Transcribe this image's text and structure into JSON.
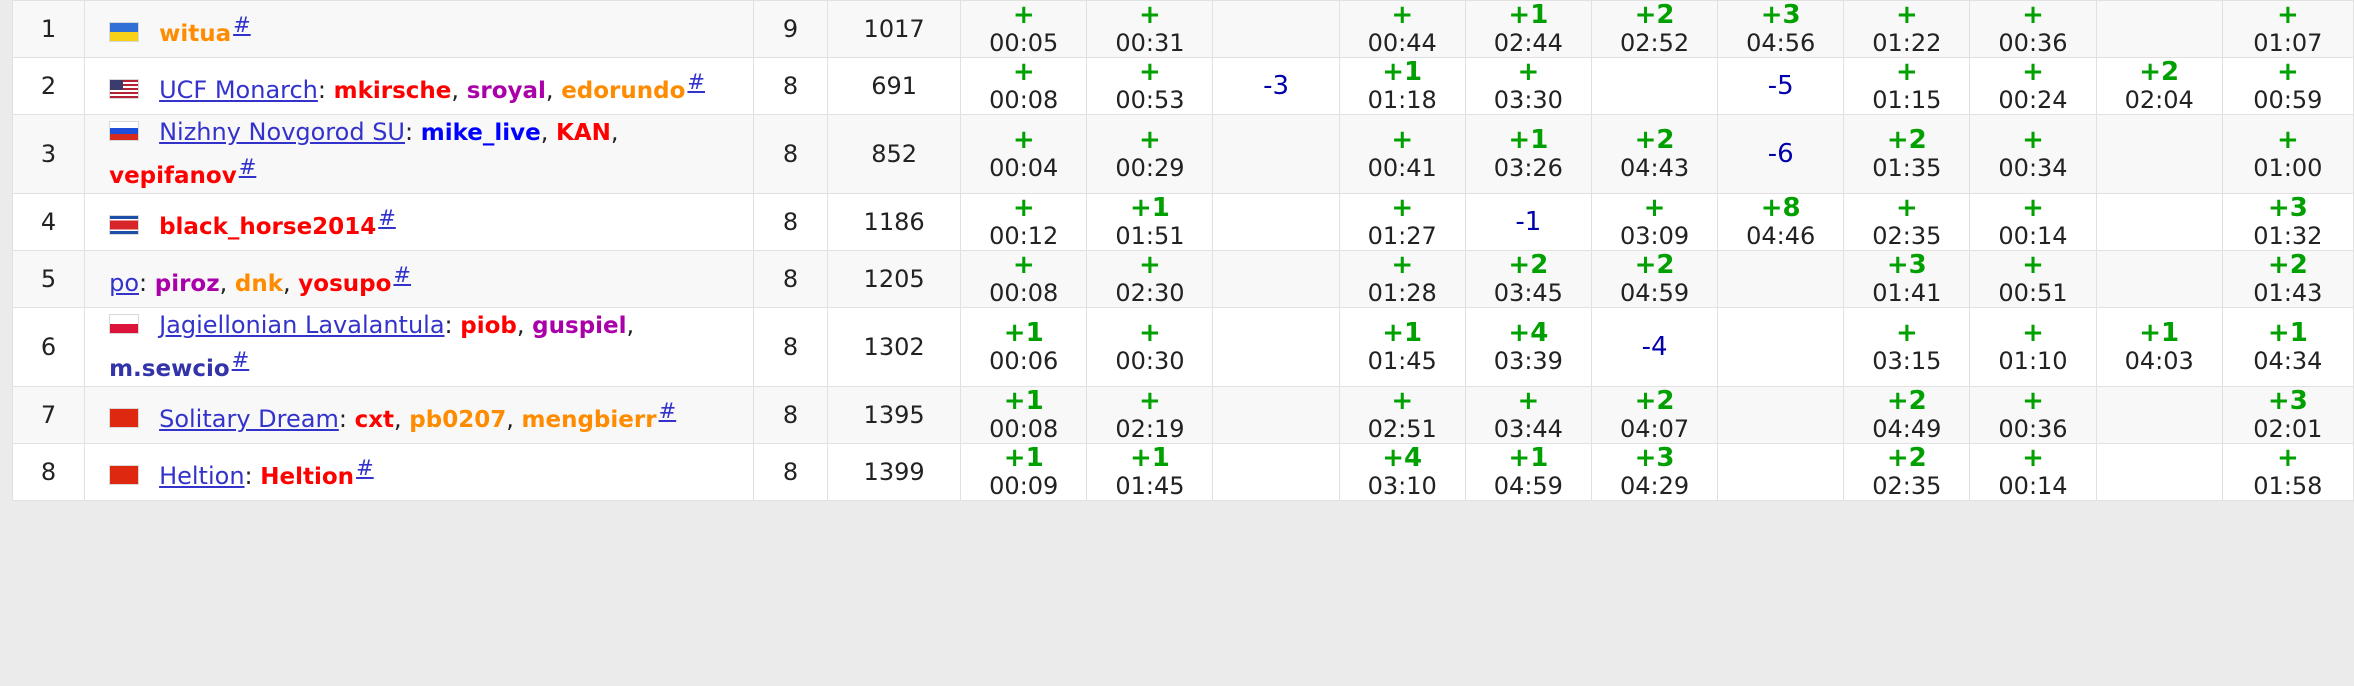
{
  "colors": {
    "accepted": "#00a000",
    "rejected": "#0000aa",
    "team_link": "#3333cc",
    "handle_red": "#ff0000",
    "handle_orange": "#ff8c00",
    "handle_violet": "#aa00aa",
    "handle_blue": "#0000ff",
    "handle_darkblue": "#3333aa"
  },
  "rows": [
    {
      "rank": "1",
      "flag": "ua",
      "team": "",
      "colon": "",
      "members": [
        {
          "name": "witua",
          "color": "#ff8c00"
        }
      ],
      "hash": "#",
      "solved": "9",
      "penalty": "1017",
      "problems": [
        {
          "res": "+",
          "time": "00:05"
        },
        {
          "res": "+",
          "time": "00:31"
        },
        {
          "res": "",
          "time": ""
        },
        {
          "res": "+",
          "time": "00:44"
        },
        {
          "res": "+1",
          "time": "02:44"
        },
        {
          "res": "+2",
          "time": "02:52"
        },
        {
          "res": "+3",
          "time": "04:56"
        },
        {
          "res": "+",
          "time": "01:22"
        },
        {
          "res": "+",
          "time": "00:36"
        },
        {
          "res": "",
          "time": ""
        },
        {
          "res": "+",
          "time": "01:07"
        }
      ]
    },
    {
      "rank": "2",
      "flag": "us",
      "team": "UCF Monarch",
      "colon": ":",
      "members": [
        {
          "name": "mkirsche",
          "color": "#ff0000"
        },
        {
          "name": "sroyal",
          "color": "#aa00aa"
        },
        {
          "name": "edorundo",
          "color": "#ff8c00"
        }
      ],
      "hash": "#",
      "solved": "8",
      "penalty": "691",
      "problems": [
        {
          "res": "+",
          "time": "00:08"
        },
        {
          "res": "+",
          "time": "00:53"
        },
        {
          "res": "-3",
          "time": ""
        },
        {
          "res": "+1",
          "time": "01:18"
        },
        {
          "res": "+",
          "time": "03:30"
        },
        {
          "res": "",
          "time": ""
        },
        {
          "res": "-5",
          "time": ""
        },
        {
          "res": "+",
          "time": "01:15"
        },
        {
          "res": "+",
          "time": "00:24"
        },
        {
          "res": "+2",
          "time": "02:04"
        },
        {
          "res": "+",
          "time": "00:59"
        }
      ]
    },
    {
      "rank": "3",
      "flag": "ru",
      "team": "Nizhny Novgorod SU",
      "colon": ":",
      "members": [
        {
          "name": "mike_live",
          "color": "#0000ff"
        },
        {
          "name": "KAN",
          "color": "#ff0000"
        },
        {
          "name": "vepifanov",
          "color": "#ff0000"
        }
      ],
      "hash": "#",
      "solved": "8",
      "penalty": "852",
      "problems": [
        {
          "res": "+",
          "time": "00:04"
        },
        {
          "res": "+",
          "time": "00:29"
        },
        {
          "res": "",
          "time": ""
        },
        {
          "res": "+",
          "time": "00:41"
        },
        {
          "res": "+1",
          "time": "03:26"
        },
        {
          "res": "+2",
          "time": "04:43"
        },
        {
          "res": "-6",
          "time": ""
        },
        {
          "res": "+2",
          "time": "01:35"
        },
        {
          "res": "+",
          "time": "00:34"
        },
        {
          "res": "",
          "time": ""
        },
        {
          "res": "+",
          "time": "01:00"
        }
      ]
    },
    {
      "rank": "4",
      "flag": "kp",
      "team": "",
      "colon": "",
      "members": [
        {
          "name": "black_horse2014",
          "color": "#ff0000"
        }
      ],
      "hash": "#",
      "solved": "8",
      "penalty": "1186",
      "problems": [
        {
          "res": "+",
          "time": "00:12"
        },
        {
          "res": "+1",
          "time": "01:51"
        },
        {
          "res": "",
          "time": ""
        },
        {
          "res": "+",
          "time": "01:27"
        },
        {
          "res": "-1",
          "time": ""
        },
        {
          "res": "+",
          "time": "03:09"
        },
        {
          "res": "+8",
          "time": "04:46"
        },
        {
          "res": "+",
          "time": "02:35"
        },
        {
          "res": "+",
          "time": "00:14"
        },
        {
          "res": "",
          "time": ""
        },
        {
          "res": "+3",
          "time": "01:32"
        }
      ]
    },
    {
      "rank": "5",
      "flag": "",
      "team": "po",
      "colon": ":",
      "members": [
        {
          "name": "piroz",
          "color": "#aa00aa"
        },
        {
          "name": "dnk",
          "color": "#ff8c00"
        },
        {
          "name": "yosupo",
          "color": "#ff0000"
        }
      ],
      "hash": "#",
      "solved": "8",
      "penalty": "1205",
      "problems": [
        {
          "res": "+",
          "time": "00:08"
        },
        {
          "res": "+",
          "time": "02:30"
        },
        {
          "res": "",
          "time": ""
        },
        {
          "res": "+",
          "time": "01:28"
        },
        {
          "res": "+2",
          "time": "03:45"
        },
        {
          "res": "+2",
          "time": "04:59"
        },
        {
          "res": "",
          "time": ""
        },
        {
          "res": "+3",
          "time": "01:41"
        },
        {
          "res": "+",
          "time": "00:51"
        },
        {
          "res": "",
          "time": ""
        },
        {
          "res": "+2",
          "time": "01:43"
        }
      ]
    },
    {
      "rank": "6",
      "flag": "pl",
      "team": "Jagiellonian Lavalantula",
      "colon": ":",
      "members": [
        {
          "name": "piob",
          "color": "#ff0000"
        },
        {
          "name": "guspiel",
          "color": "#aa00aa"
        },
        {
          "name": "m.sewcio",
          "color": "#3333aa"
        }
      ],
      "hash": "#",
      "solved": "8",
      "penalty": "1302",
      "problems": [
        {
          "res": "+1",
          "time": "00:06"
        },
        {
          "res": "+",
          "time": "00:30"
        },
        {
          "res": "",
          "time": ""
        },
        {
          "res": "+1",
          "time": "01:45"
        },
        {
          "res": "+4",
          "time": "03:39"
        },
        {
          "res": "-4",
          "time": ""
        },
        {
          "res": "",
          "time": ""
        },
        {
          "res": "+",
          "time": "03:15"
        },
        {
          "res": "+",
          "time": "01:10"
        },
        {
          "res": "+1",
          "time": "04:03"
        },
        {
          "res": "+1",
          "time": "04:34"
        }
      ]
    },
    {
      "rank": "7",
      "flag": "cn",
      "team": "Solitary Dream",
      "colon": ":",
      "members": [
        {
          "name": "cxt",
          "color": "#ff0000"
        },
        {
          "name": "pb0207",
          "color": "#ff8c00"
        },
        {
          "name": "mengbierr",
          "color": "#ff8c00"
        }
      ],
      "hash": "#",
      "solved": "8",
      "penalty": "1395",
      "problems": [
        {
          "res": "+1",
          "time": "00:08"
        },
        {
          "res": "+",
          "time": "02:19"
        },
        {
          "res": "",
          "time": ""
        },
        {
          "res": "+",
          "time": "02:51"
        },
        {
          "res": "+",
          "time": "03:44"
        },
        {
          "res": "+2",
          "time": "04:07"
        },
        {
          "res": "",
          "time": ""
        },
        {
          "res": "+2",
          "time": "04:49"
        },
        {
          "res": "+",
          "time": "00:36"
        },
        {
          "res": "",
          "time": ""
        },
        {
          "res": "+3",
          "time": "02:01"
        }
      ]
    },
    {
      "rank": "8",
      "flag": "cn",
      "team": "Heltion",
      "colon": ":",
      "members": [
        {
          "name": "Heltion",
          "color": "#ff0000"
        }
      ],
      "hash": "#",
      "solved": "8",
      "penalty": "1399",
      "problems": [
        {
          "res": "+1",
          "time": "00:09"
        },
        {
          "res": "+1",
          "time": "01:45"
        },
        {
          "res": "",
          "time": ""
        },
        {
          "res": "+4",
          "time": "03:10"
        },
        {
          "res": "+1",
          "time": "04:59"
        },
        {
          "res": "+3",
          "time": "04:29"
        },
        {
          "res": "",
          "time": ""
        },
        {
          "res": "+2",
          "time": "02:35"
        },
        {
          "res": "+",
          "time": "00:14"
        },
        {
          "res": "",
          "time": ""
        },
        {
          "res": "+",
          "time": "01:58"
        }
      ]
    }
  ]
}
